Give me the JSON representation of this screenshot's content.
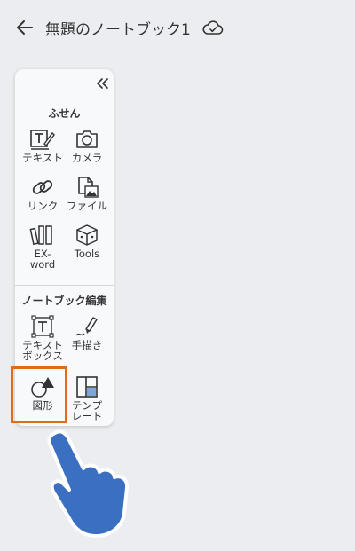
{
  "header": {
    "title": "無題のノートブック1",
    "back_icon": "arrow-left-icon",
    "sync_icon": "cloud-check-icon"
  },
  "panel": {
    "collapse_icon": "double-chevron-left-icon",
    "sections": [
      {
        "title": "ふせん",
        "items": [
          {
            "label": "テキスト",
            "icon": "text-pen-icon"
          },
          {
            "label": "カメラ",
            "icon": "camera-icon"
          },
          {
            "label": "リンク",
            "icon": "link-icon"
          },
          {
            "label": "ファイル",
            "icon": "file-image-icon"
          },
          {
            "label": "EX-\nword",
            "icon": "books-icon"
          },
          {
            "label": "Tools",
            "icon": "toolbox-icon"
          }
        ]
      },
      {
        "title": "ノートブック編集",
        "items": [
          {
            "label": "テキスト\nボックス",
            "icon": "text-box-icon"
          },
          {
            "label": "手描き",
            "icon": "pen-icon"
          },
          {
            "label": "図形",
            "icon": "shapes-icon"
          },
          {
            "label": "テンプ\nレート",
            "icon": "template-icon"
          }
        ]
      }
    ]
  },
  "highlight_color": "#e06b19",
  "hand_color": "#3a6fc1"
}
